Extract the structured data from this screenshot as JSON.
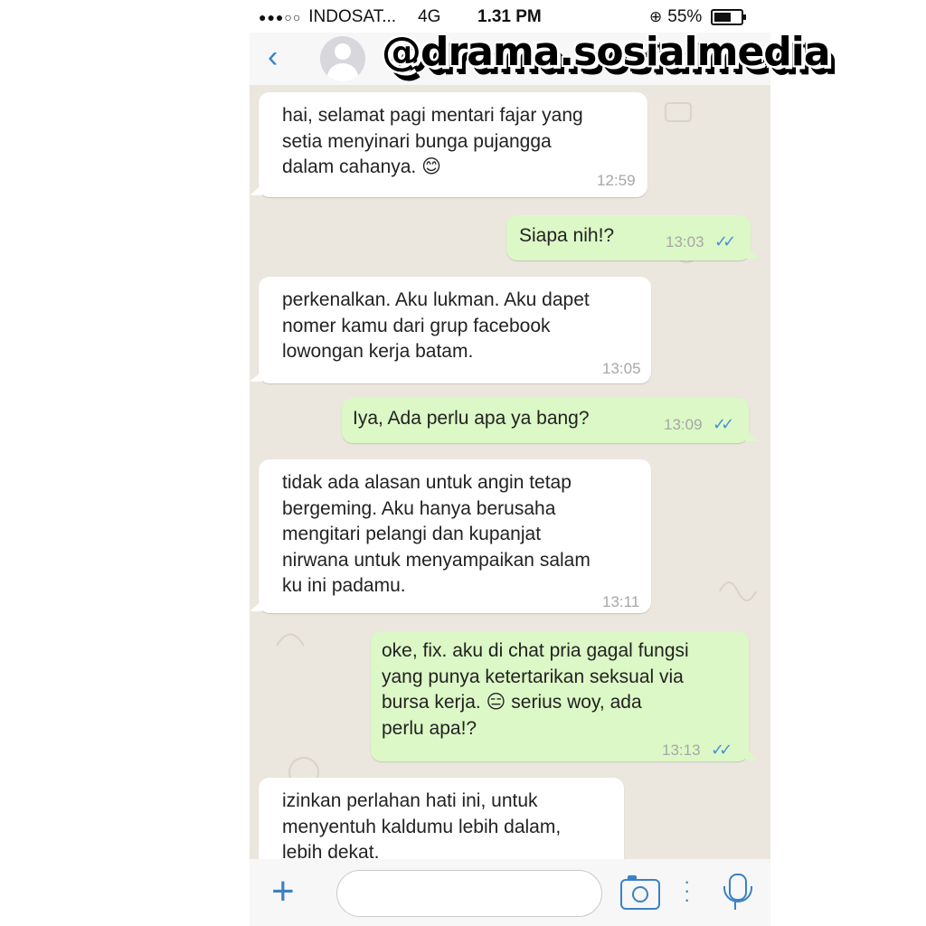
{
  "status_bar": {
    "signal": "●●●○○",
    "carrier": "INDOSAT...",
    "network": "4G",
    "time": "1.31 PM",
    "lock_icon": "rotation-lock-icon",
    "battery": "55%"
  },
  "header": {
    "back_icon": "chevron-left-icon",
    "avatar_icon": "default-avatar-icon"
  },
  "watermark": "@drama.sosialmedia",
  "messages": [
    {
      "direction": "in",
      "text": "hai, selamat pagi mentari fajar yang\nsetia menyinari bunga pujangga\ndalam cahanya. 😊",
      "time": "12:59"
    },
    {
      "direction": "out",
      "text": "Siapa nih!?",
      "time": "13:03",
      "status": "read"
    },
    {
      "direction": "in",
      "text": "perkenalkan. Aku lukman. Aku dapet\nnomer kamu dari grup facebook\nlowongan kerja batam.",
      "time": "13:05"
    },
    {
      "direction": "out",
      "text": "Iya, Ada perlu apa ya bang?",
      "time": "13:09",
      "status": "read"
    },
    {
      "direction": "in",
      "text": "tidak ada alasan untuk angin tetap\nbergeming. Aku hanya berusaha\nmengitari pelangi dan kupanjat\nnirwana untuk menyampaikan salam\nku ini padamu.",
      "time": "13:11"
    },
    {
      "direction": "out",
      "text": "oke, fix. aku di chat pria gagal fungsi\nyang punya ketertarikan seksual via\nbursa kerja. 😑 serius woy, ada\nperlu apa!?",
      "time": "13:13",
      "status": "read"
    },
    {
      "direction": "in",
      "text": "izinkan perlahan hati ini, untuk\nmenyentuh kaldumu lebih dalam,\nlebih dekat.",
      "time": ""
    }
  ],
  "input_bar": {
    "attach_icon": "plus-icon",
    "text_value": "",
    "camera_icon": "camera-icon",
    "more_icon": "vertical-dots-icon",
    "mic_icon": "microphone-icon"
  },
  "colors": {
    "incoming_bubble": "#ffffff",
    "outgoing_bubble": "#dcf8c6",
    "chat_background": "#ebe6de",
    "accent": "#3b82c4",
    "read_ticks": "#4a90d9"
  }
}
